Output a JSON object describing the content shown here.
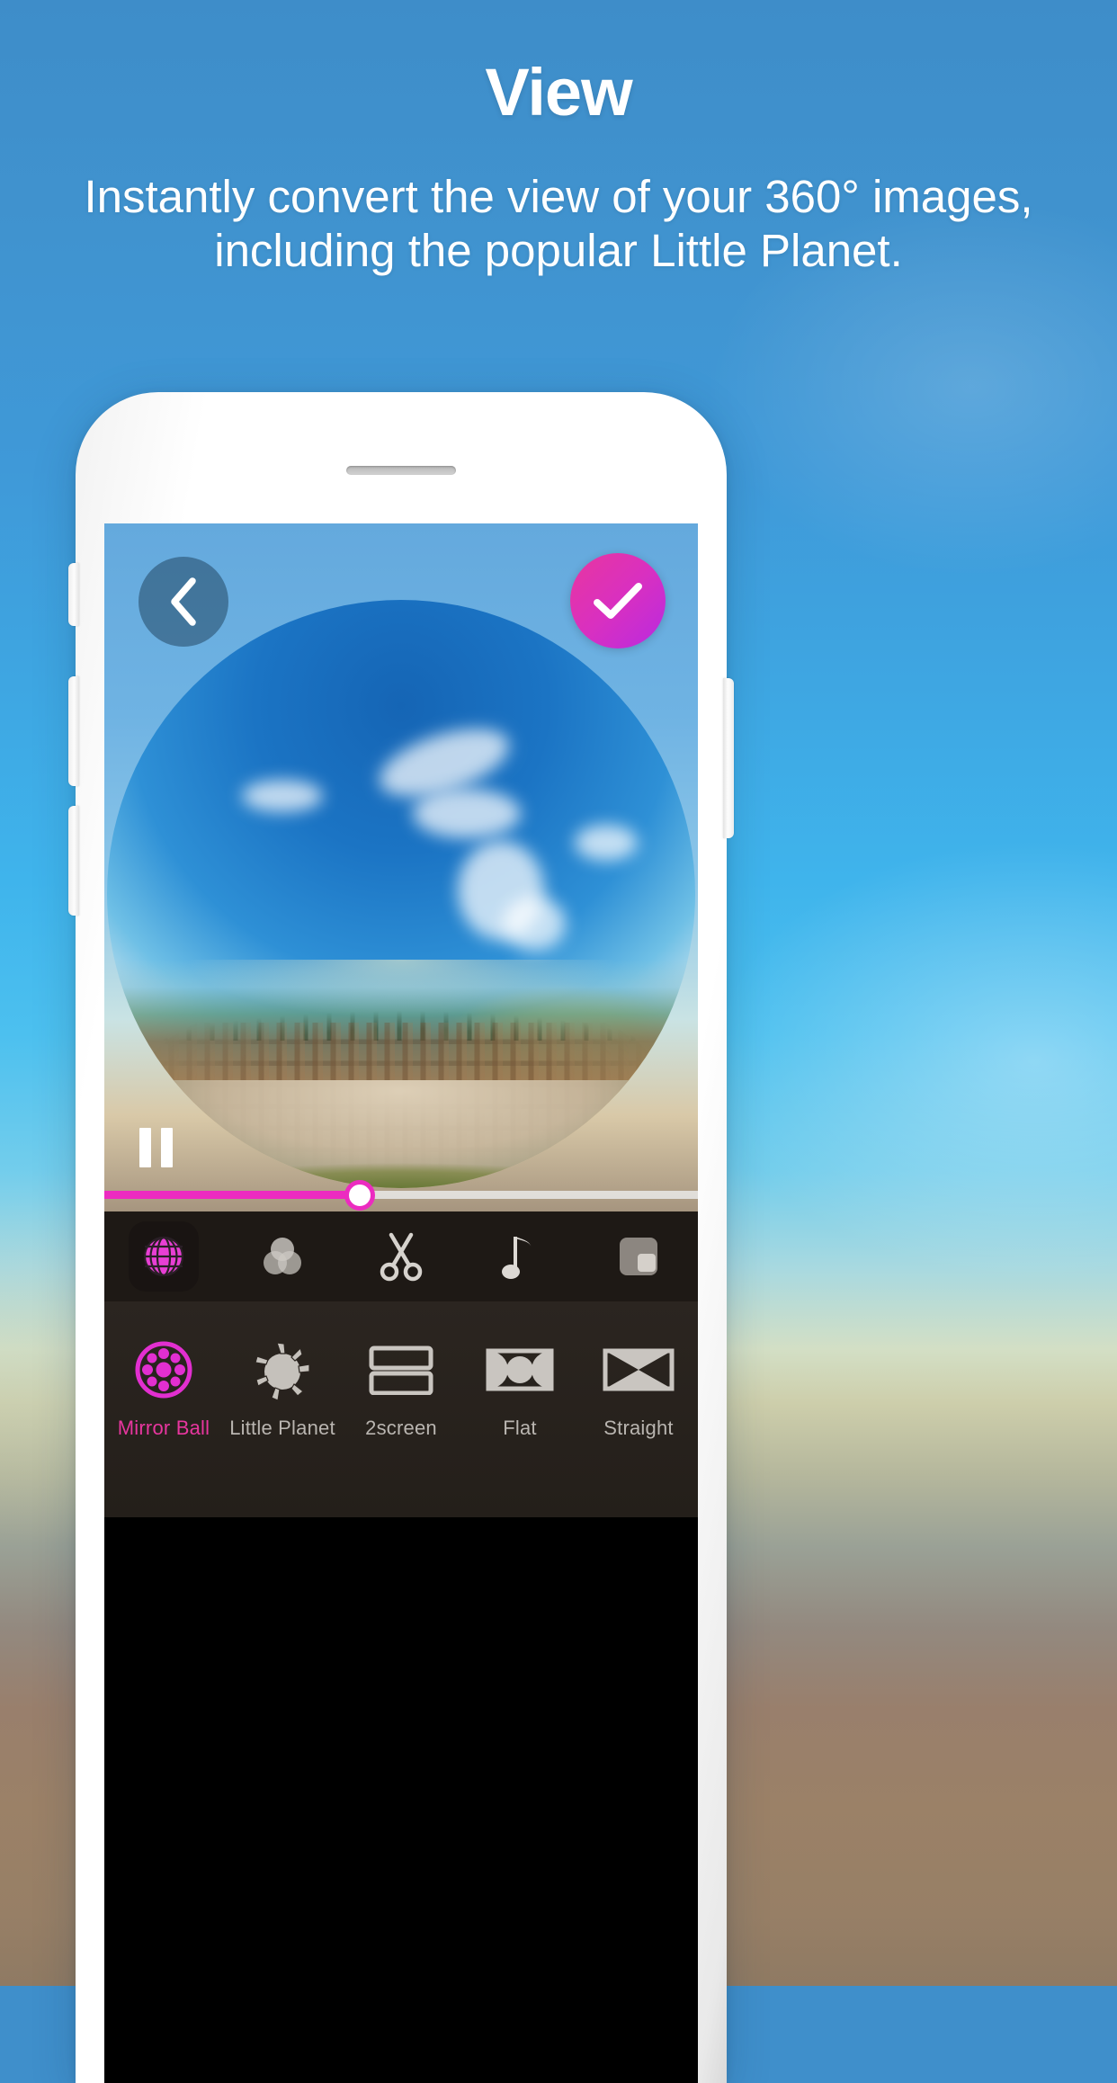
{
  "page": {
    "title": "View",
    "subtitle": "Instantly convert the view of your 360° images, including the popular Little Planet."
  },
  "colors": {
    "accent_pink": "#E8369F",
    "accent_magenta": "#EC2BC0",
    "accent_purple": "#B92AE0",
    "background_top": "#3E8DC9",
    "background_bottom": "#8F7A63",
    "filter_bar_bg": "#241F1A",
    "inactive_label": "#B9B5B0"
  },
  "app": {
    "nav": {
      "back_icon": "chevron-left-icon",
      "confirm_icon": "check-icon"
    },
    "player": {
      "state_icon": "pause-icon",
      "progress_percent": 43
    },
    "toolbar": {
      "items": [
        {
          "name": "view-mode",
          "icon": "globe-grid-icon",
          "selected": true
        },
        {
          "name": "filter",
          "icon": "color-circles-icon",
          "selected": false
        },
        {
          "name": "trim",
          "icon": "scissors-icon",
          "selected": false
        },
        {
          "name": "music",
          "icon": "music-note-icon",
          "selected": false
        },
        {
          "name": "frame",
          "icon": "frame-square-icon",
          "selected": false
        }
      ]
    },
    "filters": {
      "items": [
        {
          "label": "Mirror Ball",
          "icon": "mirror-ball-icon",
          "selected": true
        },
        {
          "label": "Little Planet",
          "icon": "little-planet-icon",
          "selected": false
        },
        {
          "label": "2screen",
          "icon": "two-screen-icon",
          "selected": false
        },
        {
          "label": "Flat",
          "icon": "flat-icon",
          "selected": false
        },
        {
          "label": "Straight",
          "icon": "straight-icon",
          "selected": false
        }
      ]
    }
  },
  "device": {
    "earpiece": "earpiece-speaker",
    "buttons": [
      "silent-switch",
      "volume-up-button",
      "volume-down-button",
      "power-button"
    ]
  }
}
